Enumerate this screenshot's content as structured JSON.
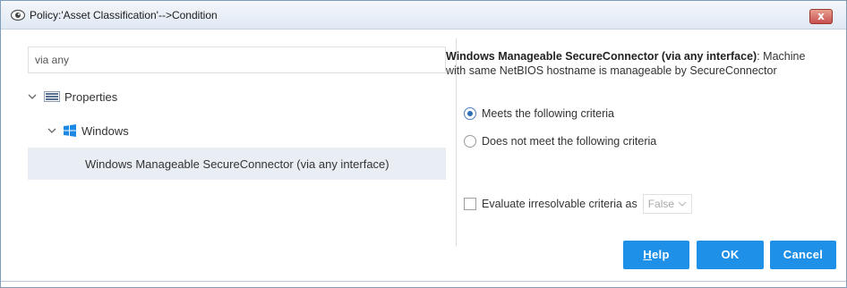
{
  "window": {
    "title": "Policy:'Asset Classification'-->Condition",
    "close_label": "x"
  },
  "search": {
    "value": "via any"
  },
  "tree": {
    "items": [
      {
        "label": "Properties"
      },
      {
        "label": "Windows"
      },
      {
        "label": "Windows Manageable SecureConnector (via any interface)"
      }
    ]
  },
  "detail": {
    "title": "Windows Manageable SecureConnector (via any interface)",
    "description": "Machine with same NetBIOS hostname is manageable by SecureConnector"
  },
  "criteria": {
    "options": [
      {
        "label": "Meets the following criteria",
        "selected": true
      },
      {
        "label": "Does not meet the following criteria",
        "selected": false
      }
    ]
  },
  "evaluate": {
    "label": "Evaluate irresolvable criteria as",
    "checked": false,
    "value": "False"
  },
  "buttons": {
    "help": "Help",
    "ok": "OK",
    "cancel": "Cancel"
  },
  "colors": {
    "accent": "#1e90e8",
    "selected_row": "#e9eef5"
  }
}
